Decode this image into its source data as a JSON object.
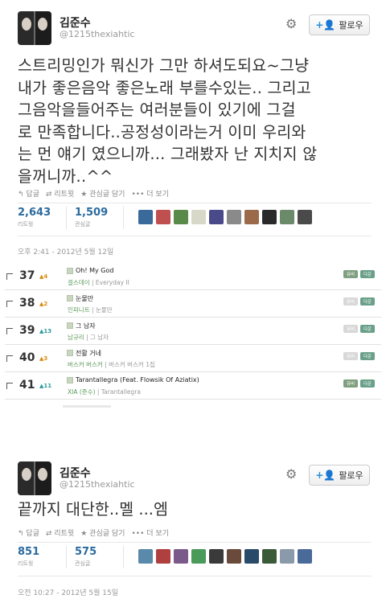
{
  "tweet1": {
    "name": "김준수",
    "handle": "@1215thexiahtic",
    "follow_label": "팔로우",
    "text_lines": [
      "스트리밍인가 뭐신가 그만 하셔도되요~그냥",
      "내가 좋은음악 좋은노래 부를수있는.. 그리고",
      "그음악을들어주는 여러분들이 있기에 그걸",
      "로 만족합니다..공정성이라는거 이미 우리와",
      "는 먼 얘기 였으니까... 그래봤자 난 지치지 않",
      "을꺼니까..^^"
    ],
    "actions": [
      "답글",
      "리트윗",
      "관심글 담기",
      "더 보기"
    ],
    "retweets": "2,643",
    "retweets_label": "리트윗",
    "favorites": "1,509",
    "favorites_label": "관심글",
    "time": "오후 2:41 - 2012년 5월 12일",
    "face_colors": [
      "#3a6a9a",
      "#c05050",
      "#5a8a4a",
      "#d8d8c8",
      "#4a4a8a",
      "#8a8a8a",
      "#9a6a4a",
      "#2a2a2a",
      "#6a8a6a",
      "#4a4a4a"
    ]
  },
  "chart": {
    "rows": [
      {
        "rank": "37",
        "change": "▲4",
        "dir": "up",
        "title": "Oh! My God",
        "artist": "걸스데이",
        "album": "Everyday II",
        "btn1": "뮤비",
        "btn1_style": "g",
        "btn2": "다운"
      },
      {
        "rank": "38",
        "change": "▲2",
        "dir": "up",
        "title": "눈물만",
        "artist": "인피니트",
        "album": "눈물만",
        "btn1": "뮤비",
        "btn1_style": "gl",
        "btn2": "다운"
      },
      {
        "rank": "39",
        "change": "▲13",
        "dir": "new",
        "title": "그 남자",
        "artist": "남규리",
        "album": "그 남자",
        "btn1": "뮤비",
        "btn1_style": "gl",
        "btn2": "다운"
      },
      {
        "rank": "40",
        "change": "▲3",
        "dir": "up",
        "title": "전활 거네",
        "artist": "버스커 버스커",
        "album": "버스커 버스커 1집",
        "btn1": "뮤비",
        "btn1_style": "gl",
        "btn2": "다운"
      },
      {
        "rank": "41",
        "change": "▲11",
        "dir": "new",
        "title": "Tarantallegra (Feat. Flowsik Of Aziatix)",
        "artist": "XIA (준수)",
        "album": "Tarantallegra",
        "btn1": "뮤비",
        "btn1_style": "g",
        "btn2": "다운"
      }
    ]
  },
  "tweet2": {
    "name": "김준수",
    "handle": "@1215thexiahtic",
    "follow_label": "팔로우",
    "text": "끝까지 대단한..멜 ...엠",
    "actions": [
      "답글",
      "리트윗",
      "관심글 담기",
      "더 보기"
    ],
    "retweets": "851",
    "retweets_label": "리트윗",
    "favorites": "575",
    "favorites_label": "관심글",
    "time": "오전 10:27 - 2012년 5월 15일",
    "face_colors": [
      "#5a8aaa",
      "#b04040",
      "#7a5a8a",
      "#4a9a5a",
      "#3a3a3a",
      "#6a4a3a",
      "#2a4a6a",
      "#3a5a3a",
      "#8a9aaa",
      "#4a6a9a"
    ]
  }
}
